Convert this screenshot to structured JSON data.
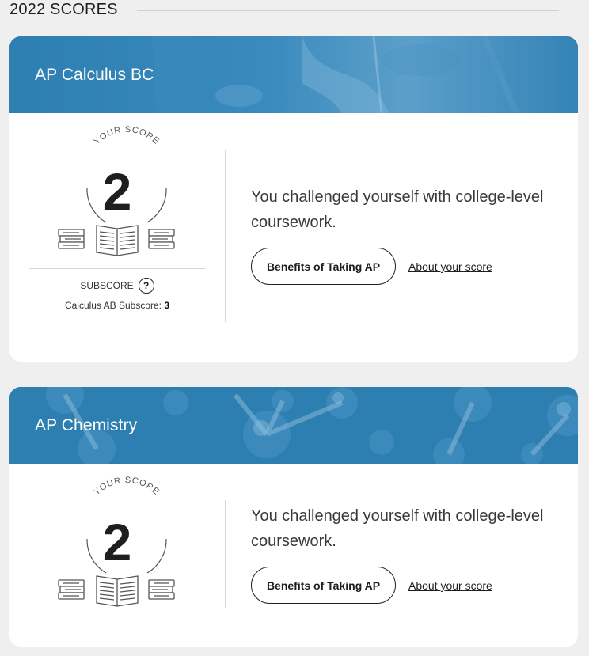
{
  "section": {
    "title": "2022 SCORES"
  },
  "cards": [
    {
      "title": "AP Calculus BC",
      "badge_label": "YOUR SCORE",
      "score": "2",
      "message": "You challenged yourself with college-level coursework.",
      "benefits_label": "Benefits of Taking AP",
      "about_label": "About your score",
      "subscore_label": "SUBSCORE",
      "subscore_help": "?",
      "subscore_name": "Calculus AB Subscore: ",
      "subscore_value": "3"
    },
    {
      "title": "AP Chemistry",
      "badge_label": "YOUR SCORE",
      "score": "2",
      "message": "You challenged yourself with college-level coursework.",
      "benefits_label": "Benefits of Taking AP",
      "about_label": "About your score"
    }
  ],
  "colors": {
    "header_blue": "#2d7eb1",
    "background": "#efefef",
    "card": "#ffffff"
  },
  "icons": {
    "books": "books-icon",
    "open_book": "open-book-icon",
    "help": "question-circle-icon"
  }
}
